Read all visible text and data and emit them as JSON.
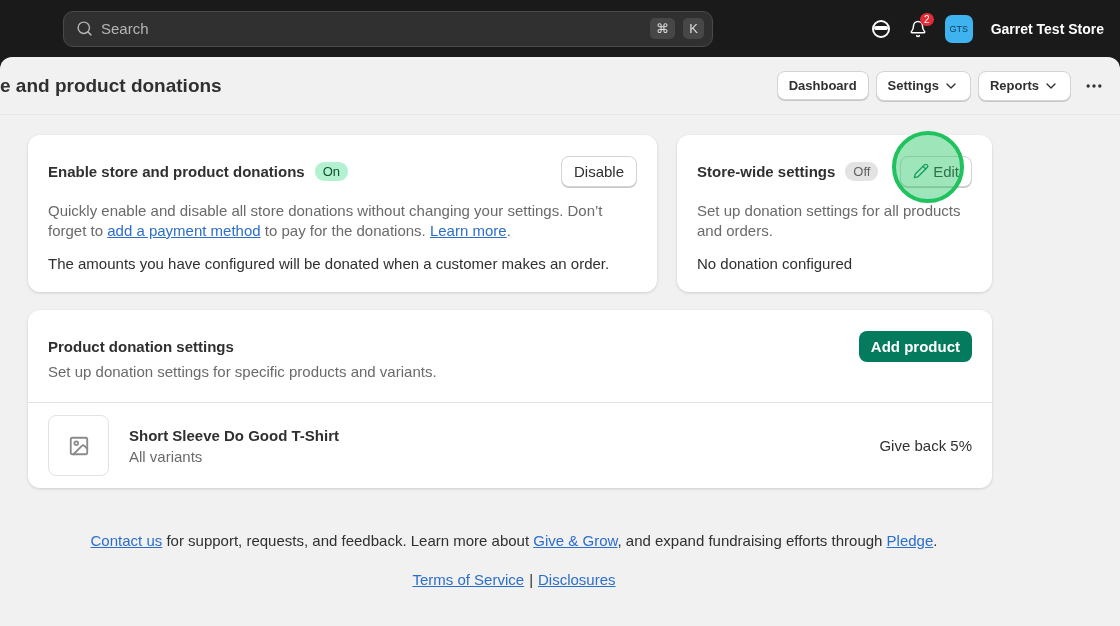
{
  "topbar": {
    "search_placeholder": "Search",
    "shortcut_keys": [
      "⌘",
      "K"
    ],
    "notification_count": "2",
    "avatar_initials": "GTS",
    "store_name": "Garret Test Store"
  },
  "header": {
    "title": "e and product donations",
    "buttons": [
      {
        "label": "Dashboard",
        "dropdown": false
      },
      {
        "label": "Settings",
        "dropdown": true
      },
      {
        "label": "Reports",
        "dropdown": true
      }
    ]
  },
  "donations_card": {
    "title": "Enable store and product donations",
    "badge": {
      "label": "On",
      "on": true
    },
    "button": "Disable",
    "description": [
      {
        "kind": "text",
        "text": "Quickly enable and disable all store donations without changing your settings. Don’t forget to "
      },
      {
        "kind": "link",
        "text": "add a payment method"
      },
      {
        "kind": "text",
        "text": " to pay for the donations. "
      },
      {
        "kind": "link",
        "text": "Learn more"
      },
      {
        "kind": "text",
        "text": "."
      }
    ],
    "note": "The amounts you have configured will be donated when a customer makes an order."
  },
  "store_wide_card": {
    "title": "Store-wide settings",
    "badge": {
      "label": "Off",
      "on": false
    },
    "button": "Edit",
    "click_highlight": true,
    "description": "Set up donation settings for all products and orders.",
    "note": "No donation configured"
  },
  "product_card": {
    "title": "Product donation settings",
    "description": "Set up donation settings for specific products and variants.",
    "button": "Add product",
    "products": [
      {
        "name": "Short Sleeve Do Good T-Shirt",
        "variants": "All variants",
        "give_back": "Give back 5%"
      }
    ]
  },
  "footer": {
    "text": [
      {
        "kind": "link",
        "text": "Contact us"
      },
      {
        "kind": "text",
        "text": " for support, requests, and feedback. Learn more about "
      },
      {
        "kind": "link",
        "text": "Give & Grow"
      },
      {
        "kind": "text",
        "text": ", and expand fundraising efforts through "
      },
      {
        "kind": "link",
        "text": "Pledge"
      },
      {
        "kind": "text",
        "text": "."
      }
    ],
    "links": [
      "Terms of Service",
      "Disclosures"
    ],
    "separator": "|"
  }
}
